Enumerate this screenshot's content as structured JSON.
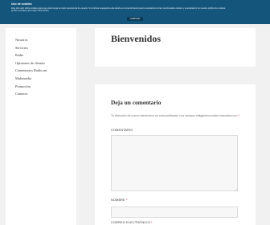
{
  "cookie_notice": {
    "title": "Uso de cookies",
    "text": "Este sitio web utiliza cookies para que usted tenga la mejor experiencia de usuario. Si continúa navegando está dando su consentimiento para la aceptación de las mencionadas cookies y la aceptación de nuestra política de cookies, pinche el enlace para mayor información.",
    "accept_label": "ACEPTAR"
  },
  "sidebar": {
    "items": [
      {
        "label": "Nosotros"
      },
      {
        "label": "Servicios"
      },
      {
        "label": "Radio"
      },
      {
        "label": "Opiniones de clientes"
      },
      {
        "label": "Comentarios Radio.net"
      },
      {
        "label": "Multimedia"
      },
      {
        "label": "Promoción"
      },
      {
        "label": "Contacto"
      }
    ]
  },
  "page": {
    "title": "Bienvenidos"
  },
  "comments": {
    "heading": "Deja un comentario",
    "notes": "Tu dirección de correo electrónico no será publicada. Los campos obligatorios están marcados con",
    "required_mark": "*",
    "comment_label": "COMENTARIO",
    "name_label": "NOMBRE",
    "email_label": "CORREO ELECTRÓNICO"
  },
  "colors": {
    "cookie_bar": "#14557b",
    "page_background": "#f1f1f1",
    "card_background": "#ffffff",
    "required": "#cc0000"
  }
}
